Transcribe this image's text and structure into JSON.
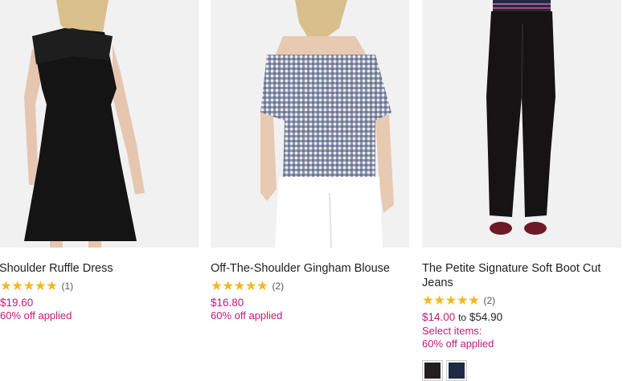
{
  "products": [
    {
      "name": "Shoulder Ruffle Dress",
      "stars": "★★★★★",
      "rating_count": "(1)",
      "price": "$19.60",
      "promo": "60% off applied"
    },
    {
      "name": "Off-The-Shoulder Gingham Blouse",
      "stars": "★★★★★",
      "rating_count": "(2)",
      "price": "$16.80",
      "promo": "60% off applied"
    },
    {
      "name": "The Petite Signature Soft Boot Cut Jeans",
      "stars": "★★★★★",
      "rating_count": "(2)",
      "price_low": "$14.00",
      "price_to": "to",
      "price_high": "$54.90",
      "promo_line1": "Select items:",
      "promo_line2": "60% off applied",
      "swatches": [
        {
          "name": "black",
          "color": "#231f20"
        },
        {
          "name": "navy",
          "color": "#1f2a44"
        }
      ]
    }
  ],
  "colors": {
    "price_accent": "#c2187a",
    "star": "#f2b824"
  }
}
